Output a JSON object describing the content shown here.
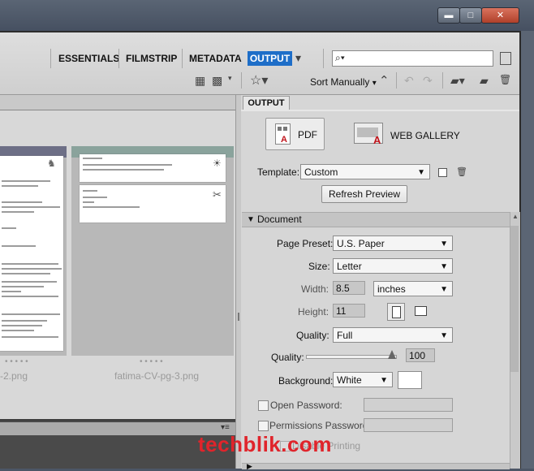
{
  "window": {
    "minimize_glyph": "▬",
    "maximize_glyph": "□",
    "close_glyph": "✕"
  },
  "workspaces": {
    "essentials": "ESSENTIALS",
    "filmstrip": "FILMSTRIP",
    "metadata": "METADATA",
    "output": "OUTPUT",
    "more_glyph": "▾"
  },
  "search": {
    "icon": "search-icon",
    "glyph": "⌕▾",
    "placeholder": ""
  },
  "toolbar": {
    "sort_label": "Sort Manually",
    "sort_arrow": "▾",
    "ascending_glyph": "⌃",
    "undo_glyph": "↶",
    "redo_glyph": "↷",
    "filter_glyph": "▦",
    "quality_glyph": "▩",
    "star_glyph": "☆▾",
    "folder_glyph": "▰▾",
    "new_folder_glyph": "▰",
    "trash_glyph": "🗑"
  },
  "thumbnails": [
    {
      "caption": "-2.png"
    },
    {
      "caption": "fatima-CV-pg-3.png"
    }
  ],
  "dots": "• • • • •",
  "panel": {
    "tab_label": "OUTPUT",
    "pdf_label": "PDF",
    "web_gallery_label": "WEB GALLERY",
    "template_label": "Template:",
    "template_value": "Custom",
    "refresh_label": "Refresh Preview",
    "document_section": "Document",
    "page_preset_label": "Page Preset:",
    "page_preset_value": "U.S. Paper",
    "size_label": "Size:",
    "size_value": "Letter",
    "width_label": "Width:",
    "width_value": "8.5",
    "unit_value": "inches",
    "height_label": "Height:",
    "height_value": "11",
    "quality_label": "Quality:",
    "quality_value": "Full",
    "quality_slider_label": "Quality:",
    "quality_slider_value": "100",
    "quality_slider_level": 1.0,
    "background_label": "Background:",
    "background_value": "White",
    "open_password_label": "Open Password:",
    "permissions_password_label": "Permissions Password:",
    "disable_printing_label": "Disable Printing"
  },
  "watermark": "techblik.com",
  "colors": {
    "accent": "#1e6ec8",
    "watermark": "#e0242b"
  }
}
